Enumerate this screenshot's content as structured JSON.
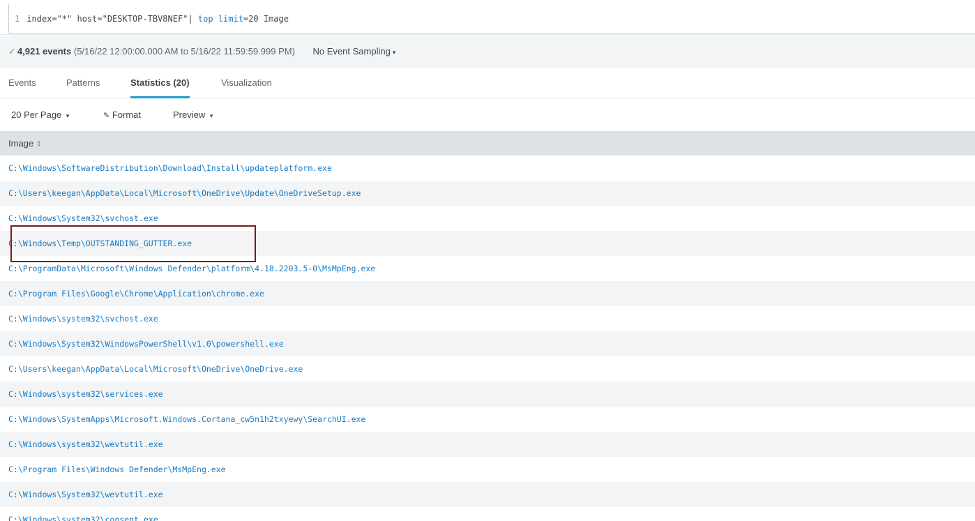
{
  "search": {
    "line_number": "1",
    "query_prefix": "index=\"*\" host=\"DESKTOP-TBV8NEF\"| ",
    "cmd_top": "top",
    "space": " ",
    "arg_limit": "limit",
    "query_suffix": "=20 Image"
  },
  "status": {
    "check": "✓",
    "event_count": "4,921 events",
    "time_range": " (5/16/22 12:00:00.000 AM to 5/16/22 11:59:59.999 PM)",
    "sampling": "No Event Sampling",
    "caret": "▾"
  },
  "tabs": [
    "Events",
    "Patterns",
    "Statistics (20)",
    "Visualization"
  ],
  "toolbar": {
    "per_page": "20 Per Page",
    "format_icon": "✓",
    "format": "Format",
    "preview": "Preview",
    "caret": "▾"
  },
  "table": {
    "column": "Image",
    "sort_icon": "⇕",
    "rows": [
      "C:\\Windows\\SoftwareDistribution\\Download\\Install\\updateplatform.exe",
      "C:\\Users\\keegan\\AppData\\Local\\Microsoft\\OneDrive\\Update\\OneDriveSetup.exe",
      "C:\\Windows\\System32\\svchost.exe",
      "C:\\Windows\\Temp\\OUTSTANDING_GUTTER.exe",
      "C:\\ProgramData\\Microsoft\\Windows Defender\\platform\\4.18.2203.5-0\\MsMpEng.exe",
      "C:\\Program Files\\Google\\Chrome\\Application\\chrome.exe",
      "C:\\Windows\\system32\\svchost.exe",
      "C:\\Windows\\System32\\WindowsPowerShell\\v1.0\\powershell.exe",
      "C:\\Users\\keegan\\AppData\\Local\\Microsoft\\OneDrive\\OneDrive.exe",
      "C:\\Windows\\system32\\services.exe",
      "C:\\Windows\\SystemApps\\Microsoft.Windows.Cortana_cw5n1h2txyewy\\SearchUI.exe",
      "C:\\Windows\\system32\\wevtutil.exe",
      "C:\\Program Files\\Windows Defender\\MsMpEng.exe",
      "C:\\Windows\\System32\\wevtutil.exe",
      "C:\\Windows\\system32\\consent.exe"
    ]
  },
  "colors": {
    "link": "#1a79c2",
    "highlight_border": "#7a1a1d",
    "active_tab": "#1a9cd0"
  }
}
